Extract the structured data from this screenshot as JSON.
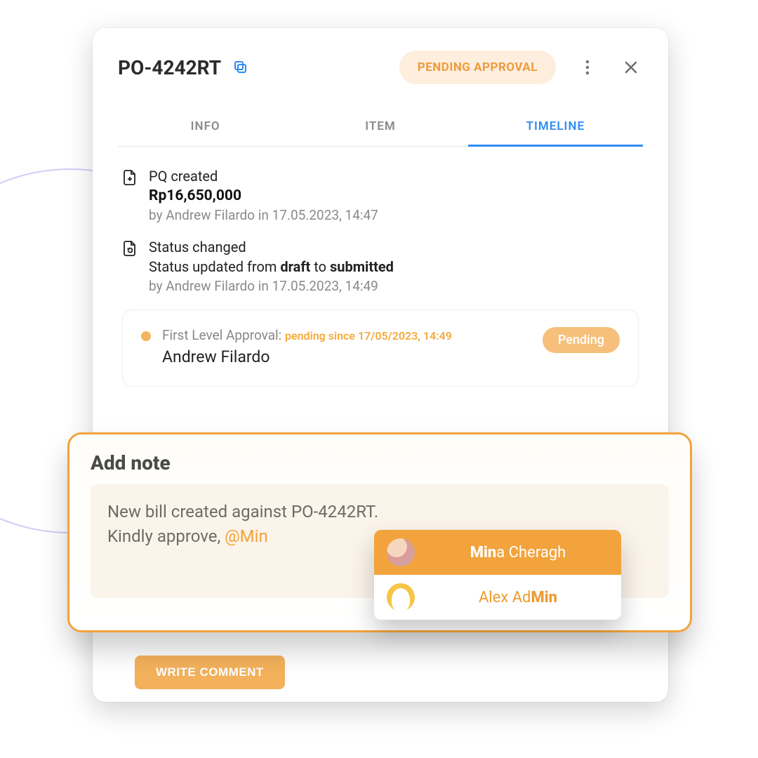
{
  "header": {
    "po_number": "PO-4242RT",
    "status_label": "PENDING APPROVAL"
  },
  "tabs": {
    "info": "INFO",
    "item": "ITEM",
    "timeline": "TIMELINE"
  },
  "timeline": {
    "created": {
      "title": "PQ created",
      "amount": "Rp16,650,000",
      "meta": "by Andrew Filardo in 17.05.2023, 14:47"
    },
    "status_change": {
      "title": "Status changed",
      "text_pre": "Status updated from ",
      "from": "draft",
      "mid": " to ",
      "to": "submitted",
      "meta": "by Andrew Filardo in 17.05.2023, 14:49"
    },
    "approval": {
      "label": "First Level Approval: ",
      "since": "pending since 17/05/2023, 14:49",
      "approver": "Andrew Filardo",
      "badge": "Pending"
    }
  },
  "note": {
    "title": "Add note",
    "line1": "New bill created against PO-4242RT.",
    "line2a": "Kindly approve, ",
    "mention_typed": "@Min"
  },
  "mention_options": [
    {
      "pre": "Min",
      "rest": "a Cheragh"
    },
    {
      "pre": "Alex Ad",
      "bold": "Min"
    }
  ],
  "buttons": {
    "write_comment": "WRITE COMMENT"
  }
}
